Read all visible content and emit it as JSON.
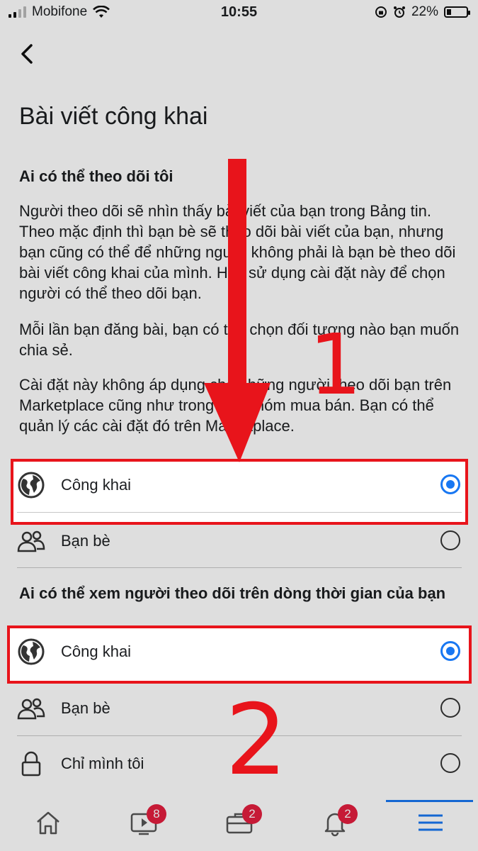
{
  "status_bar": {
    "carrier": "Mobifone",
    "time": "10:55",
    "battery": "22%",
    "battery_level": 0.22
  },
  "page": {
    "title": "Bài viết công khai"
  },
  "section1": {
    "heading": "Ai có thể theo dõi tôi",
    "paragraphs": [
      "Người theo dõi sẽ nhìn thấy bài viết của bạn trong Bảng tin. Theo mặc định thì bạn bè sẽ theo dõi bài viết của bạn, nhưng bạn cũng có thể để những người không phải là bạn bè theo dõi bài viết công khai của mình. Hãy sử dụng cài đặt này để chọn người có thể theo dõi bạn.",
      "Mỗi lần bạn đăng bài, bạn có thể chọn đối tượng nào bạn muốn chia sẻ.",
      "Cài đặt này không áp dụng cho những người theo dõi bạn trên Marketplace cũng như trong các nhóm mua bán. Bạn có thể quản lý các cài đặt đó trên Marketplace."
    ],
    "options": [
      {
        "label": "Công khai",
        "icon": "globe-icon",
        "selected": true
      },
      {
        "label": "Bạn bè",
        "icon": "friends-icon",
        "selected": false
      }
    ]
  },
  "section2": {
    "heading": "Ai có thể xem người theo dõi trên dòng thời gian của bạn",
    "options": [
      {
        "label": "Công khai",
        "icon": "globe-icon",
        "selected": true
      },
      {
        "label": "Bạn bè",
        "icon": "friends-icon",
        "selected": false
      },
      {
        "label": "Chỉ mình tôi",
        "icon": "lock-icon",
        "selected": false
      }
    ]
  },
  "annotations": {
    "marker1": "1",
    "marker2": "2",
    "color": "#e8141b"
  },
  "bottom_nav": {
    "tabs": [
      {
        "icon": "home-icon"
      },
      {
        "icon": "watch-icon",
        "badge": "8"
      },
      {
        "icon": "marketplace-icon",
        "badge": "2"
      },
      {
        "icon": "bell-icon",
        "badge": "2"
      },
      {
        "icon": "menu-icon",
        "active": true
      }
    ]
  },
  "colors": {
    "accent": "#1877f2",
    "badge": "#e41e3f"
  }
}
